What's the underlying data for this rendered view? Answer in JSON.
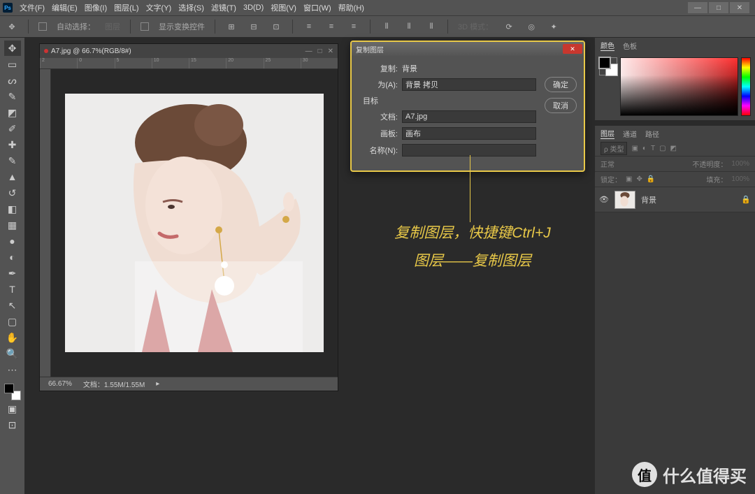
{
  "menu": [
    "文件(F)",
    "编辑(E)",
    "图像(I)",
    "图层(L)",
    "文字(Y)",
    "选择(S)",
    "滤镜(T)",
    "3D(D)",
    "视图(V)",
    "窗口(W)",
    "帮助(H)"
  ],
  "optbar": {
    "auto_select": "自动选择：",
    "layer": "图层",
    "show_transform": "显示变换控件",
    "mode3d": "3D 模式："
  },
  "doc": {
    "title": "A7.jpg @ 66.7%(RGB/8#)",
    "zoom": "66.67%",
    "docinfo": "文档：1.55M/1.55M"
  },
  "ruler_ticks": [
    "2",
    "0",
    "5",
    "10",
    "15",
    "20",
    "25",
    "30"
  ],
  "dialog": {
    "title": "复制图层",
    "dup_label": "复制:",
    "dup_value": "背景",
    "as_label": "为(A):",
    "as_value": "背景 拷贝",
    "target": "目标",
    "doc_label": "文档:",
    "doc_value": "A7.jpg",
    "artboard_label": "画板:",
    "artboard_value": "画布",
    "name_label": "名称(N):",
    "ok": "确定",
    "cancel": "取消"
  },
  "annotation": {
    "line1": "复制图层，快捷键Ctrl+J",
    "line2": "图层——复制图层"
  },
  "panels": {
    "color_tab": "颜色",
    "swatch_tab": "色板",
    "layer_tab": "图层",
    "channel_tab": "通道",
    "path_tab": "路径",
    "type_label": "ρ 类型",
    "blend": "正常",
    "opacity_label": "不透明度：",
    "opacity_val": "100%",
    "lock_label": "锁定：",
    "fill_label": "填充：",
    "fill_val": "100%",
    "layer_name": "背景"
  },
  "watermark": {
    "icon": "值",
    "text": "什么值得买"
  }
}
